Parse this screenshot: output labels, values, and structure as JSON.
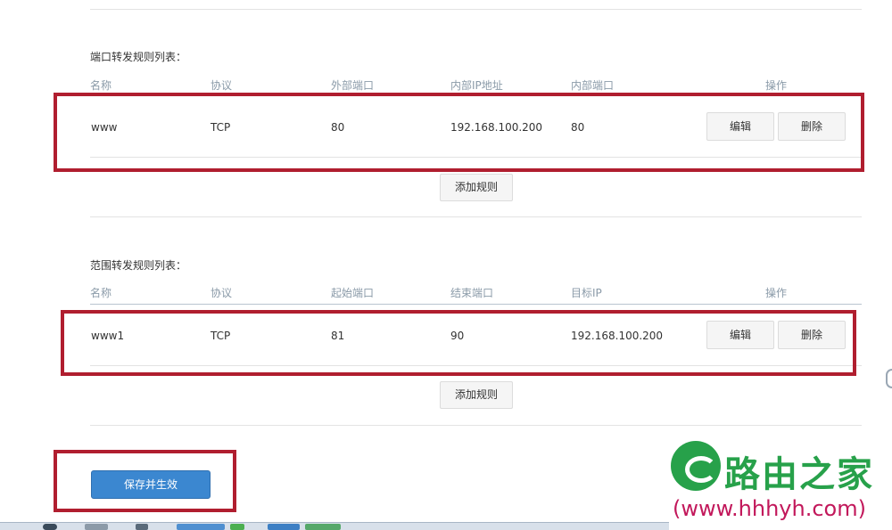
{
  "port_forwarding": {
    "title": "端口转发规则列表：",
    "headers": [
      "名称",
      "协议",
      "外部端口",
      "内部IP地址",
      "内部端口",
      "操作"
    ],
    "rows": [
      {
        "name": "www",
        "protocol": "TCP",
        "external_port": "80",
        "internal_ip": "192.168.100.200",
        "internal_port": "80"
      }
    ],
    "edit_label": "编辑",
    "delete_label": "删除",
    "add_label": "添加规则"
  },
  "range_forwarding": {
    "title": "范围转发规则列表：",
    "headers": [
      "名称",
      "协议",
      "起始端口",
      "结束端口",
      "目标IP",
      "操作"
    ],
    "rows": [
      {
        "name": "www1",
        "protocol": "TCP",
        "start_port": "81",
        "end_port": "90",
        "target_ip": "192.168.100.200"
      }
    ],
    "edit_label": "编辑",
    "delete_label": "删除",
    "add_label": "添加规则"
  },
  "save_label": "保存并生效",
  "watermark": {
    "brand": "路由之家",
    "url": "(www.hhhyh.com)"
  },
  "colors": {
    "highlight": "#b01e2f",
    "primary_button": "#3b87d0",
    "watermark_green": "#27a14a",
    "watermark_url": "#c2185b"
  }
}
